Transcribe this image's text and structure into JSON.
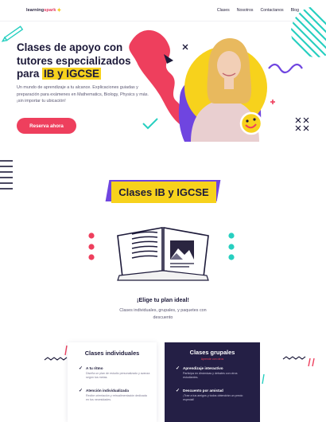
{
  "nav": {
    "logo_text_a": "learning",
    "logo_text_b": "spark",
    "links": [
      "Clases",
      "Nosotros",
      "Contactanos",
      "Blog"
    ]
  },
  "hero": {
    "title_line1": "Clases de apoyo con",
    "title_line2": "tutores especializados",
    "title_pre": "para ",
    "title_highlight": "IB y IGCSE",
    "subtitle": "Un mundo de aprendizaje a tu alcance. Explicaciones guiadas y preparación para exámenes en Mathematics, Biology, Physics y más. ¡sin importar tu ubicación!",
    "cta_label": "Reserva ahora"
  },
  "section2": {
    "heading": "Clases IB y IGCSE",
    "plan_title": "¡Elige tu plan ideal!",
    "plan_subtitle": "Clases individuales, grupales, y paquetes con descuento"
  },
  "cards": {
    "individual": {
      "title": "Clases individuales",
      "features": [
        {
          "title": "A tu ritmo",
          "desc": "Diseña un plan de estudio personalizado y avanza según tus metas."
        },
        {
          "title": "Atención individualizada",
          "desc": "Recibe orientación y retroalimentación dedicada en tus necesidades."
        }
      ]
    },
    "group": {
      "title": "Clases grupales",
      "tag": "Aprende con otros",
      "features": [
        {
          "title": "Aprendizaje interactivo",
          "desc": "Participa en dinámicas y debates con otros estudiantes."
        },
        {
          "title": "Descuento por amistad",
          "desc": "¡Trae a tus amigos y todos obtendrán un precio especial!"
        }
      ]
    }
  },
  "colors": {
    "accent_red": "#ee3f5d",
    "accent_yellow": "#f7d21c",
    "accent_purple": "#6f45e0",
    "navy": "#241f45",
    "teal": "#27cfc0",
    "pink": "#ee3f5d"
  }
}
